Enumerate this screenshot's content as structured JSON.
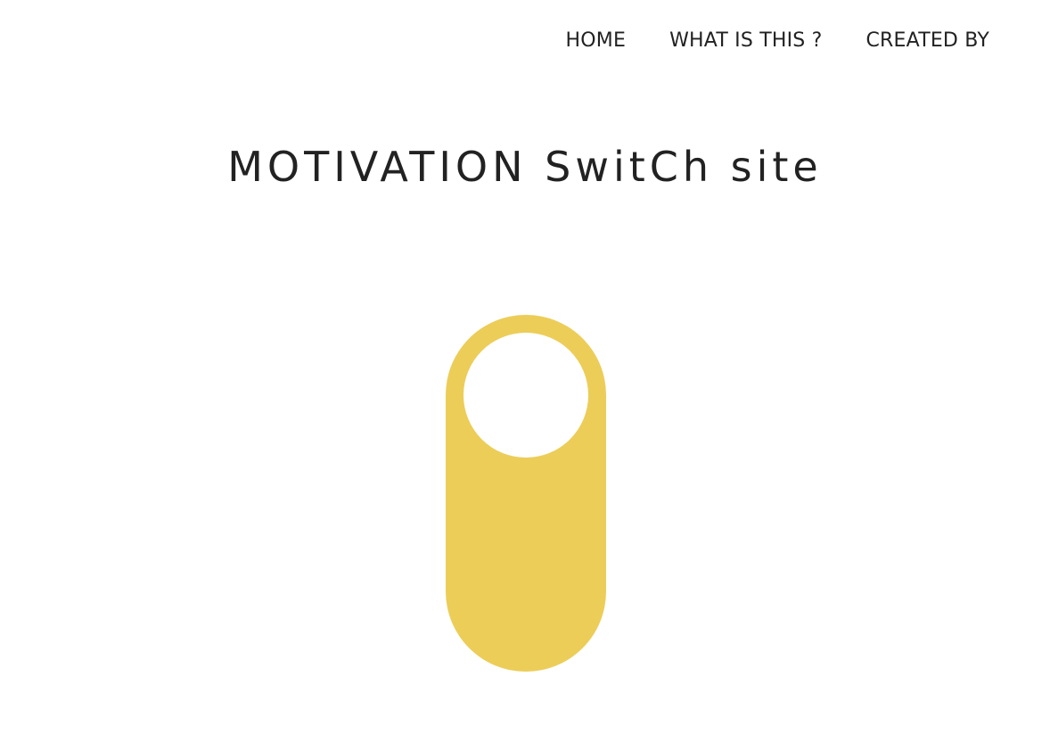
{
  "nav": {
    "items": [
      {
        "label": "HOME"
      },
      {
        "label": "WHAT IS THIS ?"
      },
      {
        "label": "CREATED BY"
      }
    ]
  },
  "header": {
    "title": "MOTIVATION SwitCh site"
  },
  "switch": {
    "state": "on",
    "color": "#eccd58",
    "knob_color": "#ffffff"
  }
}
